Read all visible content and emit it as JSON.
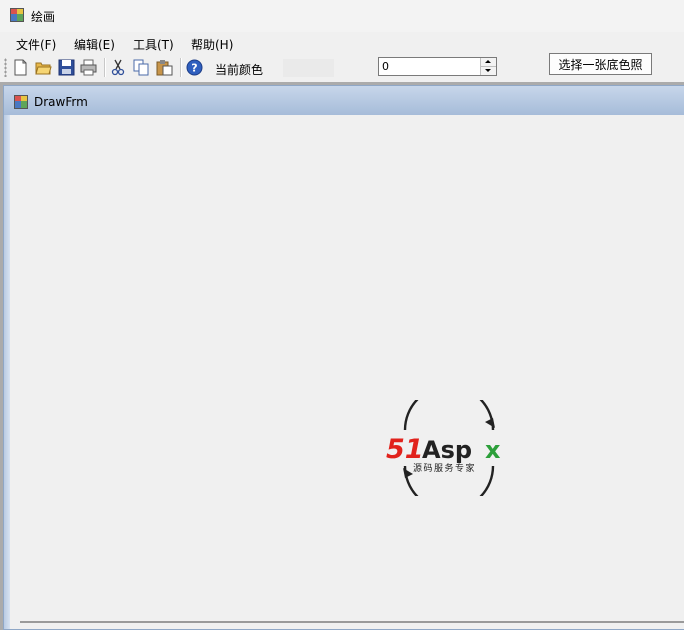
{
  "window": {
    "title": "绘画"
  },
  "menu": {
    "items": [
      "文件(F)",
      "编辑(E)",
      "工具(T)",
      "帮助(H)"
    ]
  },
  "toolbar": {
    "buttons": [
      "new-file-icon",
      "open-folder-icon",
      "save-icon",
      "print-icon",
      "cut-icon",
      "copy-icon",
      "paste-icon",
      "help-icon"
    ],
    "current_color_label": "当前颜色",
    "current_color": "#eaeaea",
    "spin_value": "0",
    "choose_bg_label": "选择一张底色照"
  },
  "child_window": {
    "title": "DrawFrm"
  },
  "watermark": {
    "brand_red": "51",
    "brand_dark": "Asp",
    "brand_green": "x",
    "tagline": "源码服务专家",
    "colors": {
      "red": "#e1221c",
      "dark": "#222222",
      "green": "#2c9f3a"
    }
  }
}
